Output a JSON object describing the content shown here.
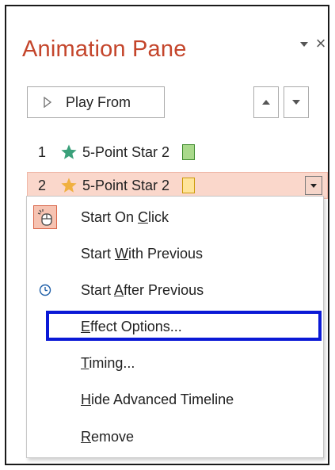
{
  "pane": {
    "title": "Animation Pane",
    "play_label": "Play From"
  },
  "animations": [
    {
      "number": "1",
      "name": "5-Point Star 2",
      "star_color": "#3aa07a",
      "timing": "green"
    },
    {
      "number": "2",
      "name": "5-Point Star 2",
      "star_color": "#f0b040",
      "timing": "yellow",
      "selected": true
    }
  ],
  "context_menu": {
    "items": [
      {
        "pre": "Start On ",
        "u": "C",
        "post": "lick",
        "icon": "mouse-click-icon",
        "checked": true
      },
      {
        "pre": "Start ",
        "u": "W",
        "post": "ith Previous",
        "icon": ""
      },
      {
        "pre": "Start ",
        "u": "A",
        "post": "fter Previous",
        "icon": "clock-icon"
      },
      {
        "pre": "",
        "u": "E",
        "post": "ffect Options...",
        "icon": "",
        "highlighted": true
      },
      {
        "pre": "",
        "u": "T",
        "post": "iming...",
        "icon": ""
      },
      {
        "pre": "",
        "u": "H",
        "post": "ide Advanced Timeline",
        "icon": ""
      },
      {
        "pre": "",
        "u": "R",
        "post": "emove",
        "icon": ""
      }
    ]
  },
  "colors": {
    "title": "#c4452b",
    "selected_row": "#fad7cb",
    "highlight_border": "#0a19d6"
  }
}
